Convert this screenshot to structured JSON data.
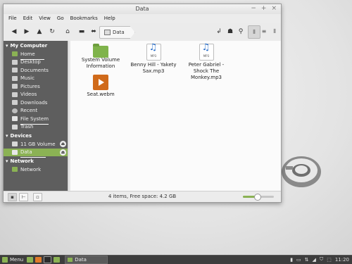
{
  "window": {
    "title": "Data",
    "controls": [
      "−",
      "+",
      "×"
    ]
  },
  "menubar": [
    "File",
    "Edit",
    "View",
    "Go",
    "Bookmarks",
    "Help"
  ],
  "toolbar": {
    "icons": [
      "back-arrow",
      "forward-arrow",
      "up-arrow",
      "reload",
      "home",
      "computer",
      "location"
    ],
    "breadcrumb": "Data"
  },
  "sidebar": {
    "sections": [
      {
        "title": "My Computer",
        "items": [
          "Home",
          "Desktop",
          "Documents",
          "Music",
          "Pictures",
          "Videos",
          "Downloads",
          "Recent",
          "File System",
          "Trash"
        ]
      },
      {
        "title": "Devices",
        "items": [
          "11 GB Volume",
          "Data"
        ]
      },
      {
        "title": "Network",
        "items": [
          "Network"
        ]
      }
    ]
  },
  "files": [
    {
      "name": "System Volume Information",
      "type": "folder"
    },
    {
      "name": "Benny Hill - Yakety Sax.mp3",
      "type": "audio",
      "badge": "MP3"
    },
    {
      "name": "Peter Gabriel - Shock The Monkey.mp3",
      "type": "audio",
      "badge": "MP3"
    },
    {
      "name": "Seat.webm",
      "type": "video"
    }
  ],
  "status": {
    "text": "4 items, Free space: 4.2 GB",
    "zoom_fraction": 0.45
  },
  "panel": {
    "menu_label": "Menu",
    "task_label": "Data",
    "clock": "11:20"
  },
  "colors": {
    "accent": "#8bb254",
    "sidebar_bg": "#5e5e5e",
    "folder": "#7fb34b"
  }
}
